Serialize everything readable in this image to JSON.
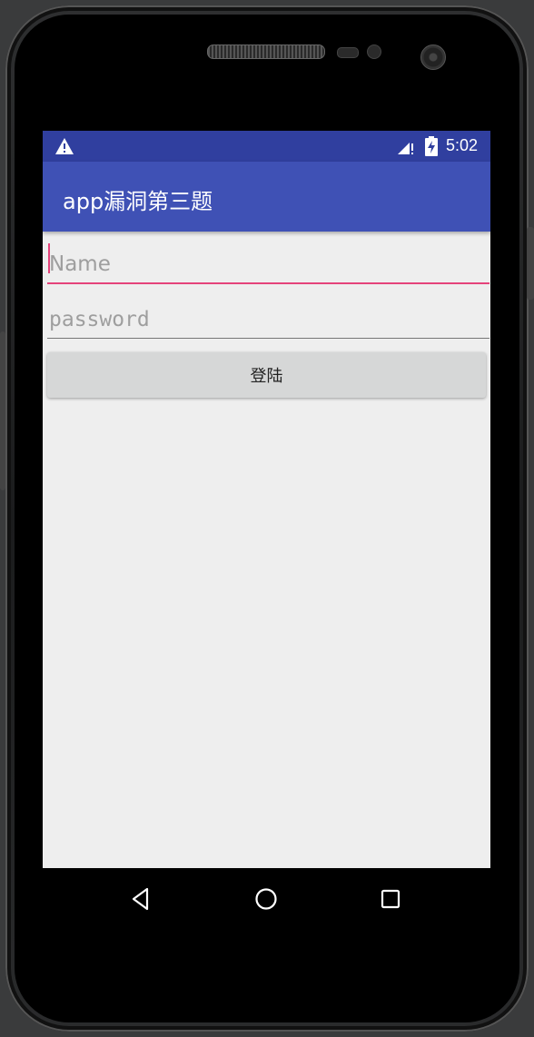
{
  "status_bar": {
    "time": "5:02",
    "icons": [
      "warning-icon",
      "signal-icon",
      "battery-charging-icon"
    ]
  },
  "app_bar": {
    "title": "app漏洞第三题"
  },
  "form": {
    "name_placeholder": "Name",
    "name_value": "",
    "password_placeholder": "password",
    "password_value": "",
    "login_label": "登陆"
  },
  "nav_bar": {
    "icons": [
      "back-icon",
      "home-icon",
      "recents-icon"
    ]
  },
  "colors": {
    "status_bar": "#303f9f",
    "app_bar": "#3f51b5",
    "accent": "#e5437a",
    "background": "#eeeeee",
    "button": "#d6d7d7"
  }
}
